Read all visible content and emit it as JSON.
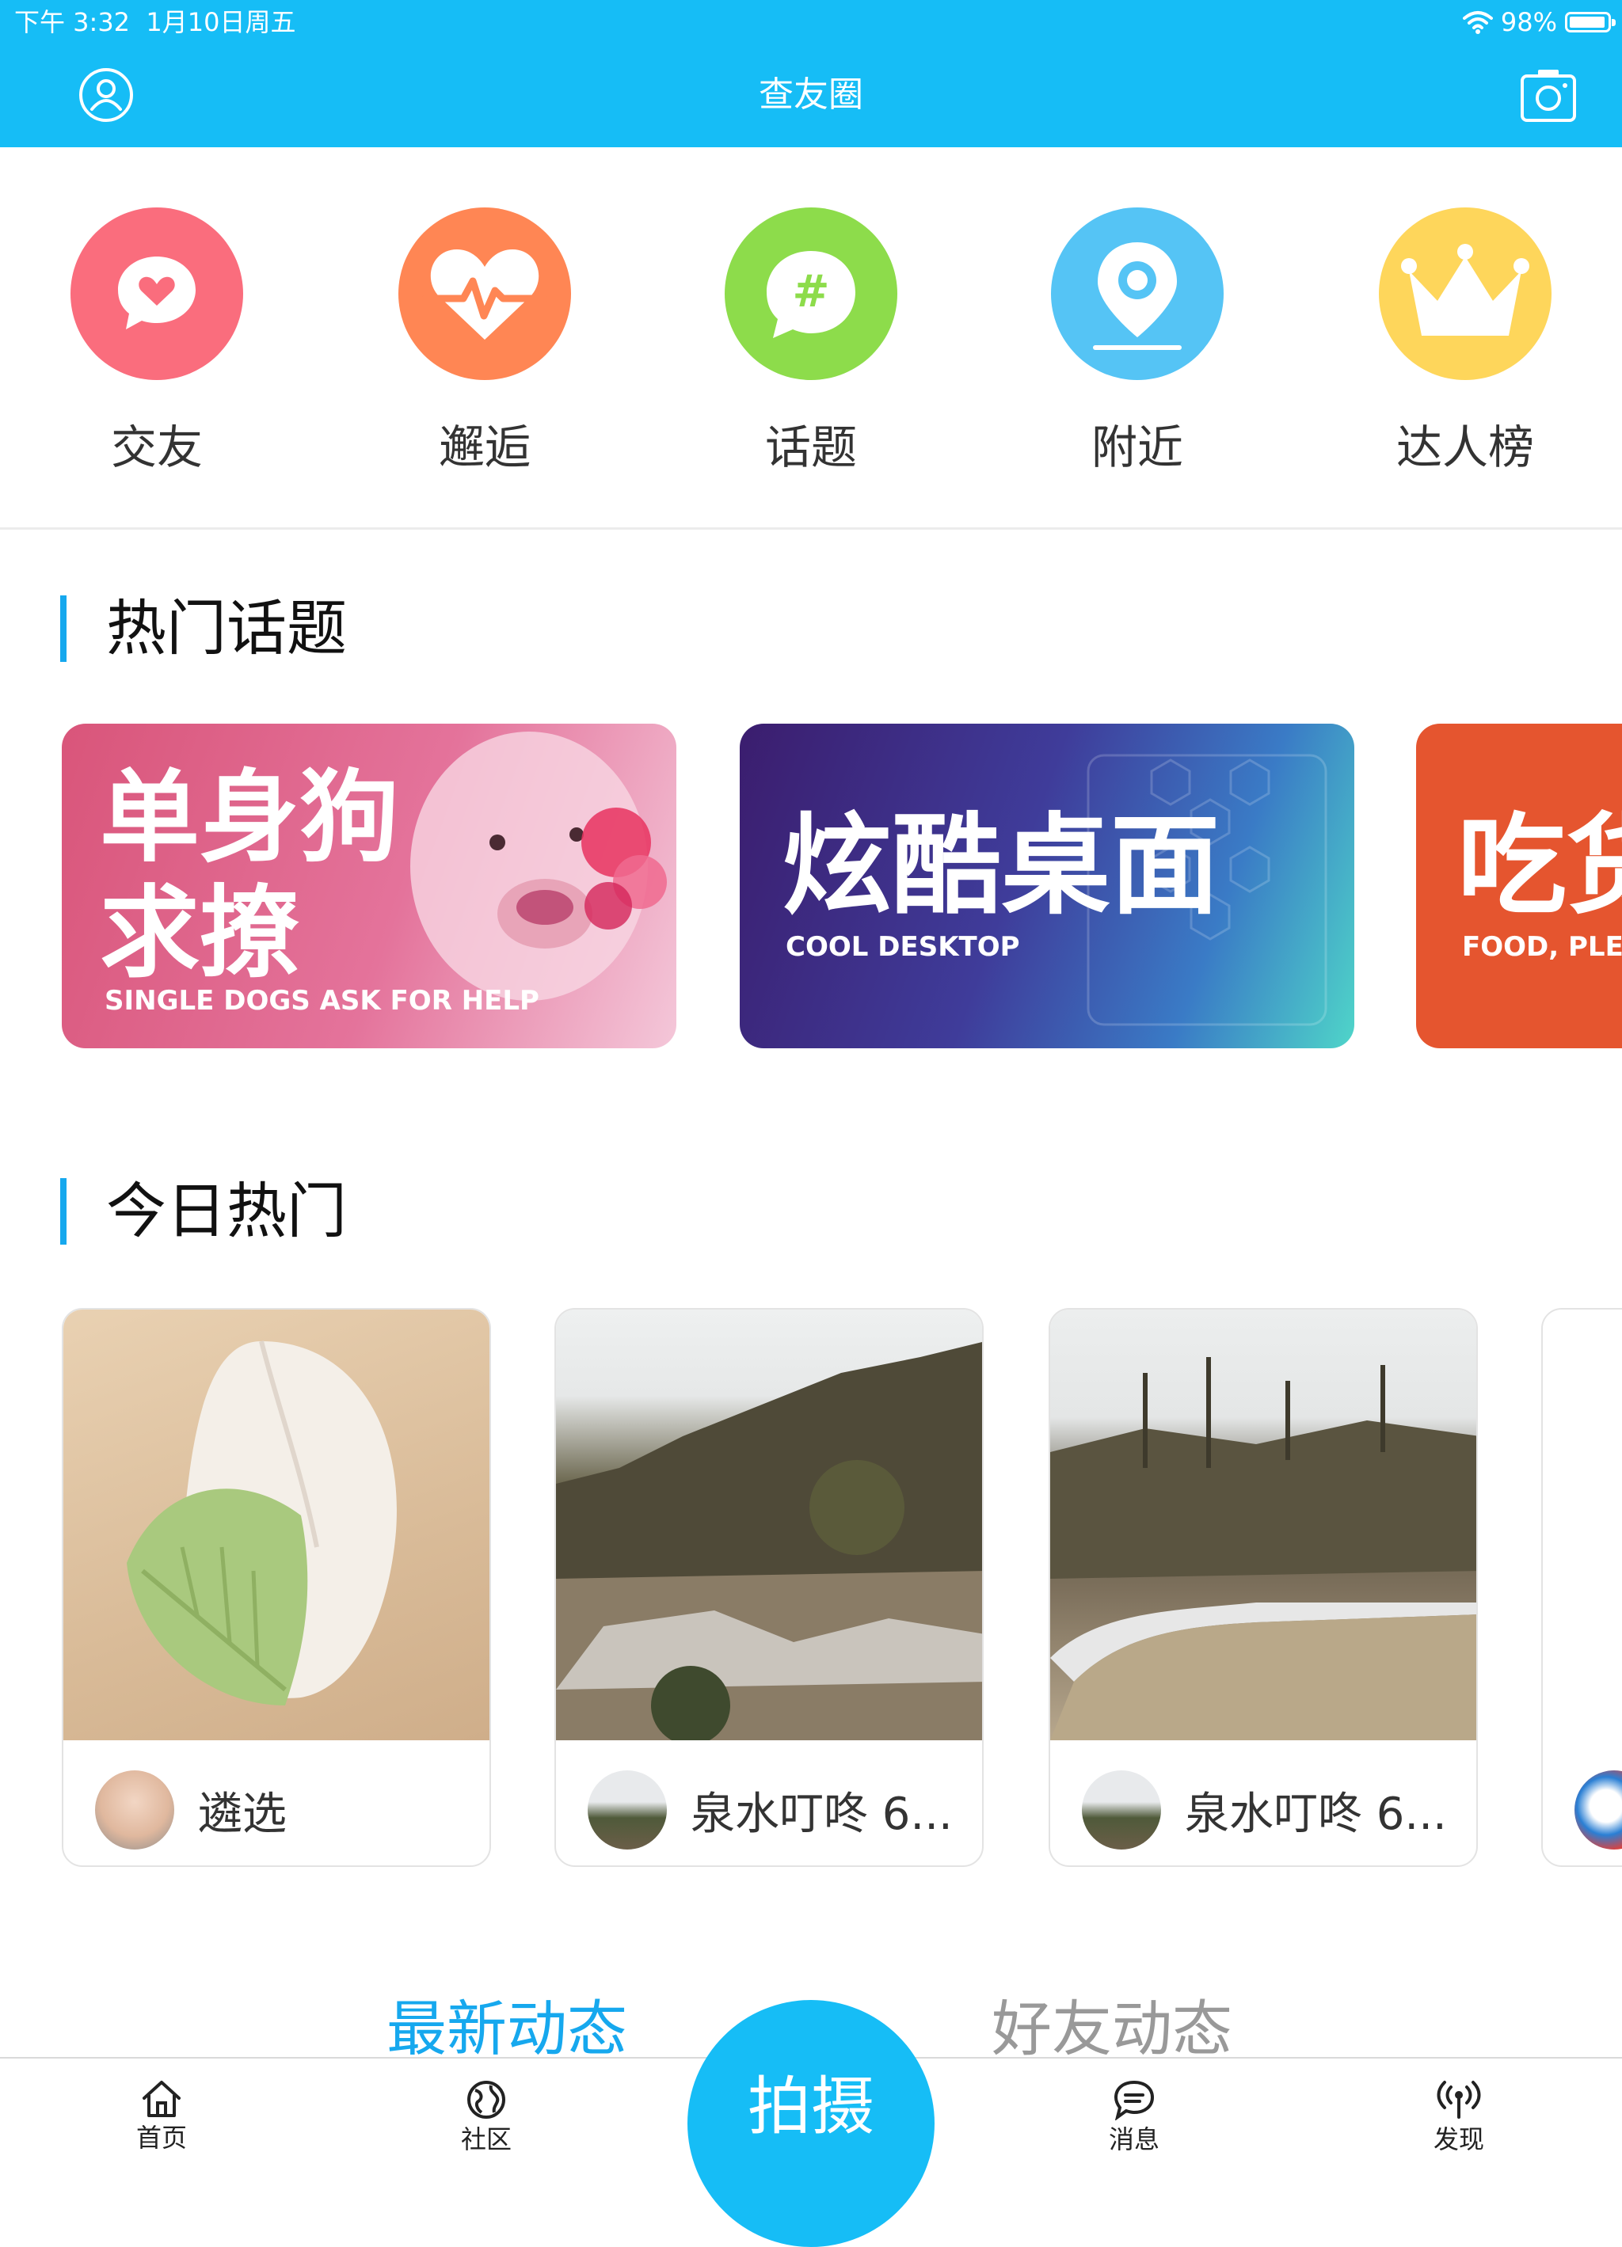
{
  "status_bar": {
    "time": "下午 3:32",
    "date": "1月10日周五",
    "battery": "98%"
  },
  "header": {
    "title": "查友圈"
  },
  "categories": [
    {
      "label": "交友",
      "color": "#fa6d7d",
      "icon": "heart-chat-icon"
    },
    {
      "label": "邂逅",
      "color": "#ff8654",
      "icon": "heartbeat-icon"
    },
    {
      "label": "话题",
      "color": "#8ddc4b",
      "icon": "hashtag-icon"
    },
    {
      "label": "附近",
      "color": "#55c4f5",
      "icon": "location-pin-icon"
    },
    {
      "label": "达人榜",
      "color": "#fed65b",
      "icon": "crown-icon"
    }
  ],
  "sections": {
    "hot_topics": "热门话题",
    "today_hot": "今日热门"
  },
  "banners": [
    {
      "title_line1": "单身狗",
      "title_line2": "求撩",
      "subtitle": "SINGLE DOGS ASK FOR HELP"
    },
    {
      "title": "炫酷桌面",
      "subtitle": "COOL DESKTOP"
    },
    {
      "title": "吃货",
      "subtitle": "FOOD, PLEASE"
    }
  ],
  "hot_posts": [
    {
      "user": "遴选"
    },
    {
      "user": "泉水叮咚 6..."
    },
    {
      "user": "泉水叮咚 6..."
    }
  ],
  "feed_tabs": {
    "latest": "最新动态",
    "friends": "好友动态"
  },
  "tabbar": {
    "home": "首页",
    "community": "社区",
    "shoot": "拍摄",
    "messages": "消息",
    "discover": "发现"
  },
  "colors": {
    "primary": "#16bdf6",
    "accent_blue": "#16a8ee"
  }
}
